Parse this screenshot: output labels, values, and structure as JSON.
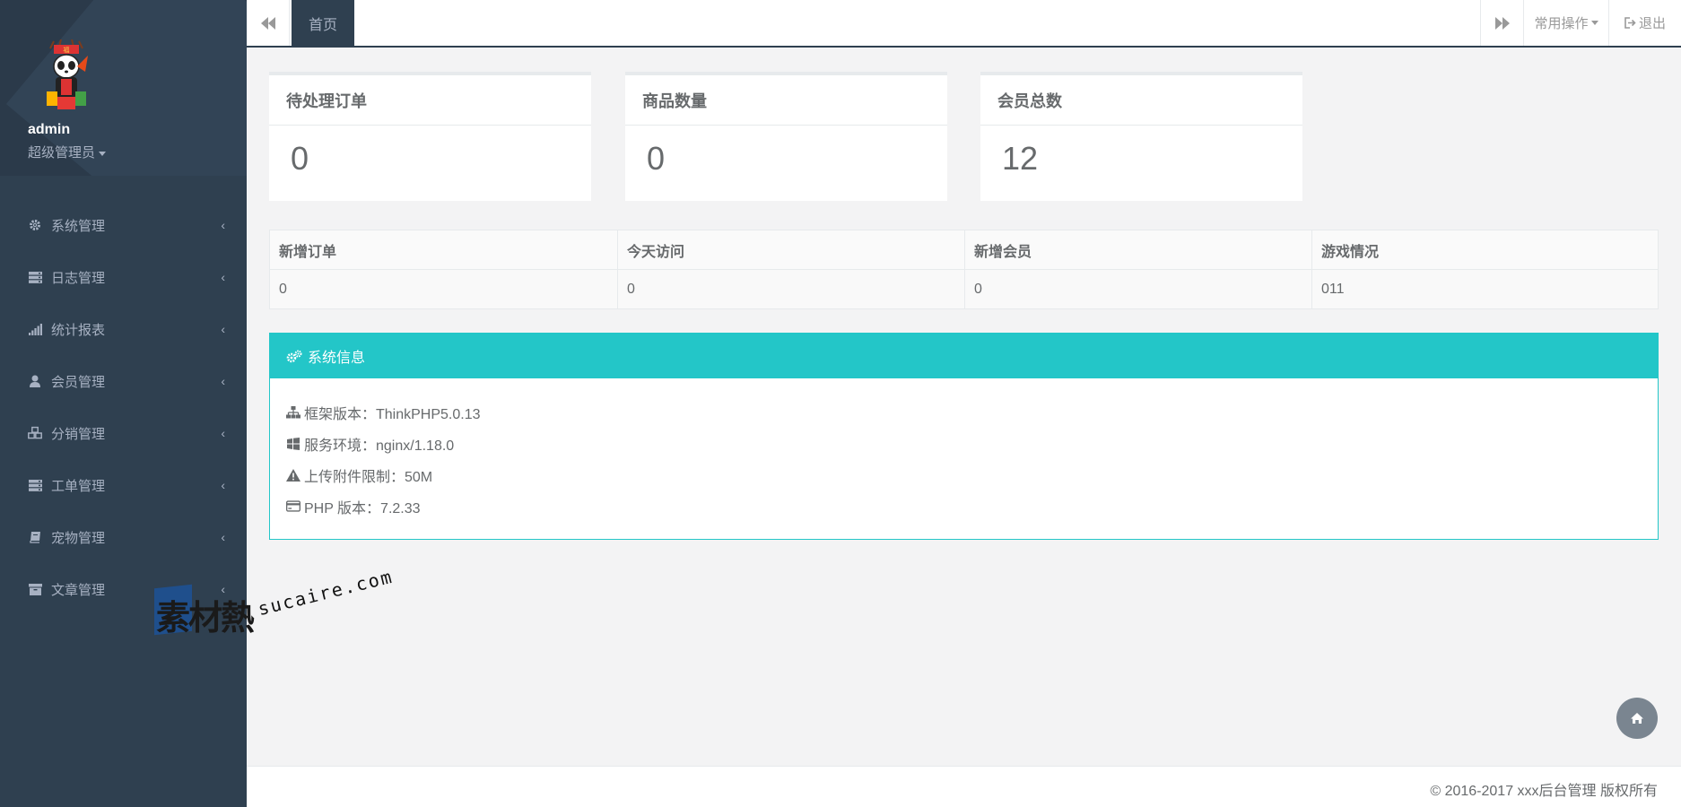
{
  "sidebar": {
    "user": {
      "name": "admin",
      "role": "超级管理员"
    },
    "items": [
      {
        "label": "系统管理",
        "icon": "gear-icon"
      },
      {
        "label": "日志管理",
        "icon": "server-icon"
      },
      {
        "label": "统计报表",
        "icon": "signal-icon"
      },
      {
        "label": "会员管理",
        "icon": "user-icon"
      },
      {
        "label": "分销管理",
        "icon": "cubes-icon"
      },
      {
        "label": "工单管理",
        "icon": "server-icon"
      },
      {
        "label": "宠物管理",
        "icon": "book-icon"
      },
      {
        "label": "文章管理",
        "icon": "archive-icon"
      }
    ]
  },
  "topbar": {
    "tab_home": "首页",
    "ops_label": "常用操作",
    "exit_label": "退出"
  },
  "cards": [
    {
      "title": "待处理订单",
      "value": "0"
    },
    {
      "title": "商品数量",
      "value": "0"
    },
    {
      "title": "会员总数",
      "value": "12"
    }
  ],
  "stats_table": {
    "headers": [
      "新增订单",
      "今天访问",
      "新增会员",
      "游戏情况"
    ],
    "values": [
      "0",
      "0",
      "0",
      "011"
    ]
  },
  "sysinfo": {
    "title": "系统信息",
    "rows": [
      {
        "label": "框架版本：ThinkPHP5.0.13",
        "icon": "sitemap-icon"
      },
      {
        "label": "服务环境：nginx/1.18.0",
        "icon": "windows-icon"
      },
      {
        "label": "上传附件限制：50M",
        "icon": "warning-icon"
      },
      {
        "label": "PHP 版本：7.2.33",
        "icon": "credit-card-icon"
      }
    ]
  },
  "watermark": {
    "cn": "素材熱",
    "en": "sucaire.com"
  },
  "footer": {
    "copyright": "© 2016-2017 xxx后台管理 版权所有"
  },
  "colors": {
    "sidebar": "#2f4050",
    "accent": "#23c6c8",
    "text": "#676a6c"
  }
}
